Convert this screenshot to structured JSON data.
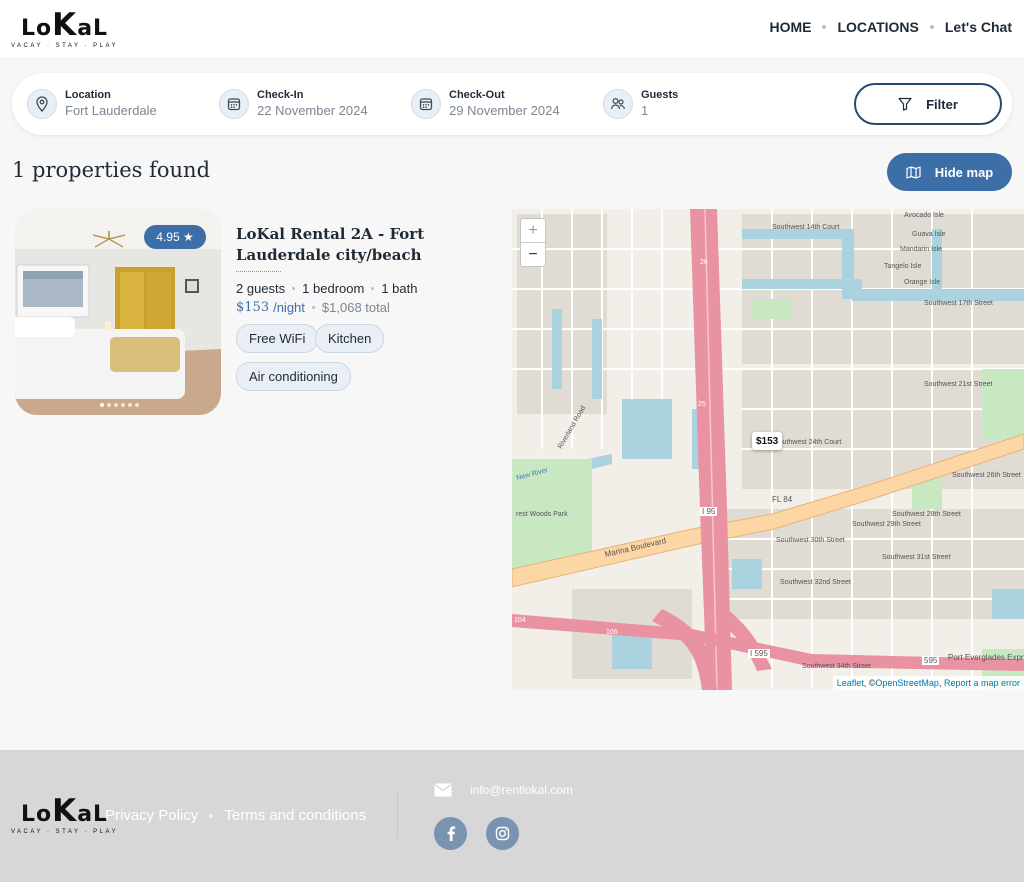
{
  "brand": {
    "logo_left": "Lo",
    "logo_k": "K",
    "logo_right": "aL",
    "tagline": "VACAY · STAY · PLAY"
  },
  "nav": {
    "items": [
      {
        "label": "HOME"
      },
      {
        "label": "LOCATIONS"
      },
      {
        "label": "Let's Chat"
      }
    ]
  },
  "search": {
    "location": {
      "label": "Location",
      "value": "Fort Lauderdale",
      "icon": "map-pin-icon"
    },
    "checkin": {
      "label": "Check-In",
      "value": "22 November 2024",
      "icon": "calendar-icon"
    },
    "checkout": {
      "label": "Check-Out",
      "value": "29 November 2024",
      "icon": "calendar-icon"
    },
    "guests": {
      "label": "Guests",
      "value": "1",
      "icon": "users-icon"
    },
    "filter_label": "Filter"
  },
  "results": {
    "title": "1 properties found",
    "hide_map_label": "Hide map"
  },
  "property": {
    "rating": "4.95 ★",
    "title": "LoKal Rental 2A - Fort Lauderdale city/beach",
    "guests": "2 guests",
    "bedrooms": "1 bedroom",
    "baths": "1 bath",
    "price": "$153",
    "per": "/night",
    "total": "$1,068 total",
    "amenities": [
      "Free WiFi",
      "Kitchen",
      "Air conditioning"
    ],
    "photo_count": 6,
    "photo_index": 0
  },
  "map": {
    "marker_price": "$153",
    "zoom_in": "+",
    "zoom_out": "−",
    "attribution_leaflet": "Leaflet",
    "attribution_sep": ", © ",
    "attribution_osm": "OpenStreetMap",
    "attribution_report": "Report a map error",
    "labels": {
      "marina": "Marina Boulevard",
      "fl84": "FL 84",
      "i95": "I 95",
      "i595": "I 595",
      "r595": "595",
      "port": "Port Everglades Expre",
      "riverland": "Riverland Road",
      "newriver": "New River",
      "woods": "rest Woods Park",
      "sw24": "Southwest 24th Court",
      "sw28": "Southwest 28th Street",
      "sw29": "Southwest 29th Street",
      "sw30": "Southwest 30th Street",
      "sw32": "Southwest 32nd Street",
      "sw34": "Southwest 34th Street",
      "sw31": "Southwest 31st Street",
      "sw14": "Southwest 14th Court",
      "sw17": "Southwest 17th Street",
      "sw21": "Southwest 21st Street",
      "sw26": "Southwest 26th Street",
      "avocado": "Avocado Isle",
      "guava": "Guava Isle",
      "mandarin": "Mandarin Isle",
      "tangelo": "Tangelo Isle",
      "orange": "Orange Isle",
      "r26": "26",
      "r25": "25",
      "r106": "106",
      "r104": "104"
    }
  },
  "footer": {
    "privacy": "Privacy Policy",
    "terms": "Terms and conditions",
    "email": "info@rentlokal.com",
    "social": [
      "facebook-icon",
      "instagram-icon"
    ]
  },
  "colors": {
    "accent": "#3c6ea8",
    "navy": "#27496d",
    "chip_bg": "#e9eff5",
    "footer_bg": "#d7d7d7"
  }
}
